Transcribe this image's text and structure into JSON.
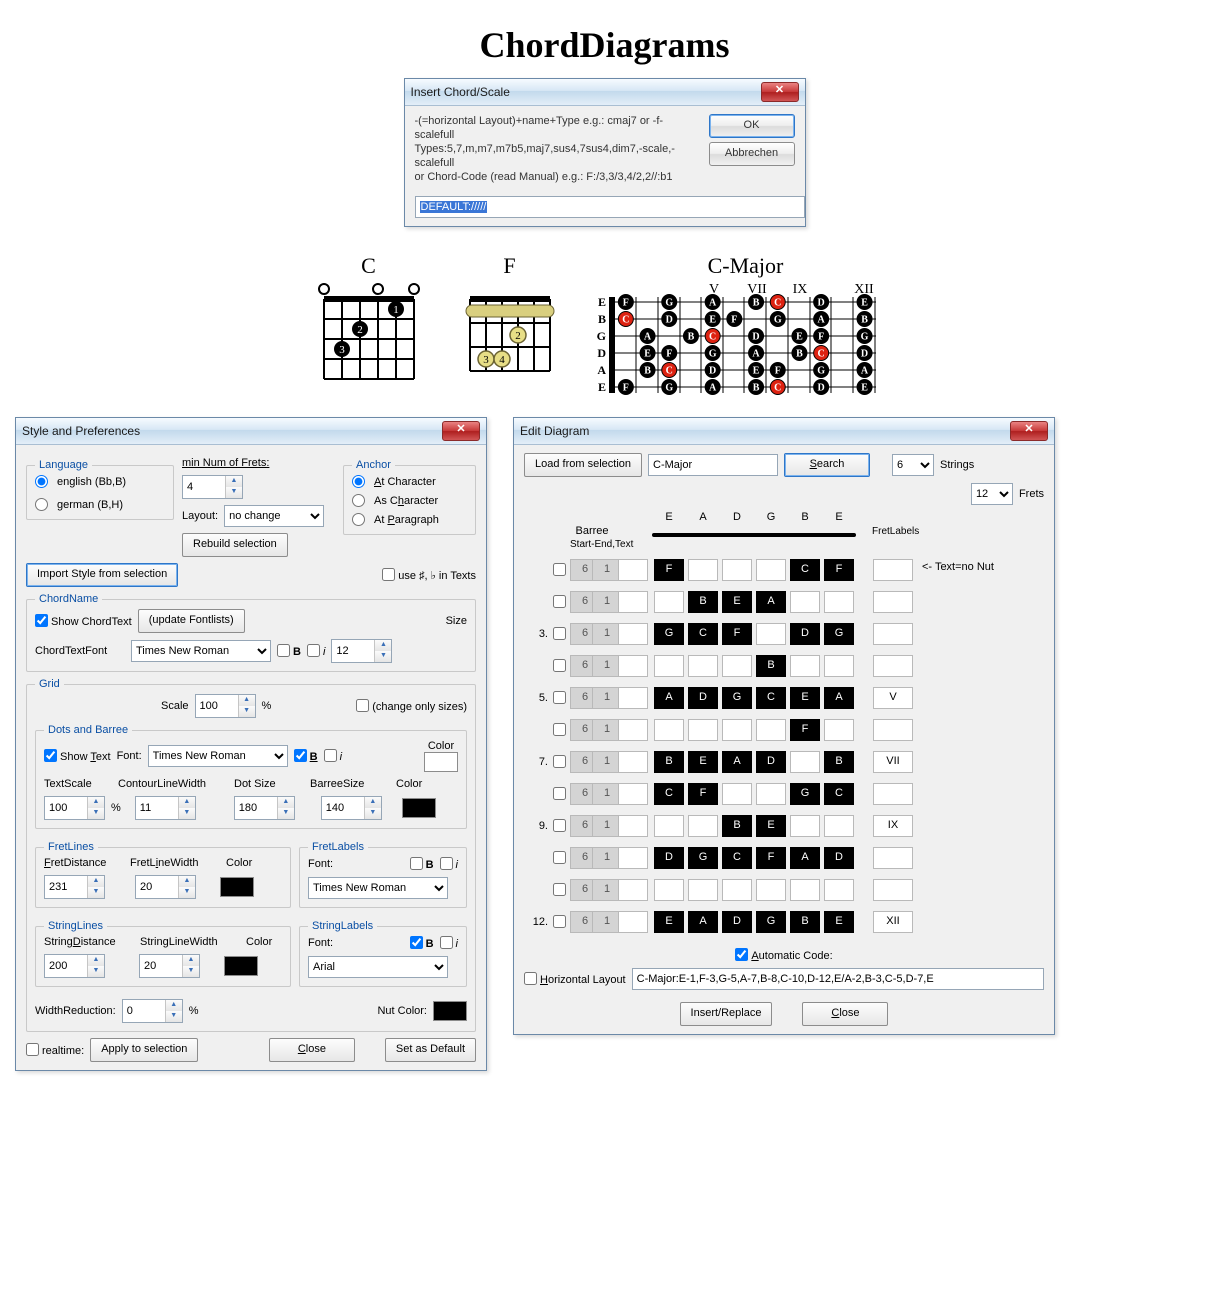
{
  "title": "ChordDiagrams",
  "insert_dialog": {
    "title": "Insert Chord/Scale",
    "help_line1": "-(=horizontal Layout)+name+Type e.g.: cmaj7 or -f-scalefull",
    "help_line2": "Types:5,7,m,m7,m7b5,maj7,sus4,7sus4,dim7,-scale,-scalefull",
    "help_line3": "or Chord-Code (read Manual) e.g.: F:/3,3/3,4/2,2//:b1",
    "ok": "OK",
    "cancel": "Abbrechen",
    "value": "DEFAULT://///"
  },
  "samples": {
    "c_title": "C",
    "f_title": "F",
    "cmajor_title": "C-Major"
  },
  "style_dialog": {
    "title": "Style and Preferences",
    "language_legend": "Language",
    "english": "english (Bb,B)",
    "german": "german (B,H)",
    "min_frets_label": "min Num of Frets:",
    "min_frets": "4",
    "layout_label": "Layout:",
    "layout_value": "no change",
    "rebuild": "Rebuild selection",
    "anchor_legend": "Anchor",
    "anchor_at_char_u": "A",
    "anchor_at_char": "t Character",
    "anchor_as_char": "As C",
    "anchor_as_char_u": "h",
    "anchor_as_char2": "aracter",
    "anchor_at_para": "At ",
    "anchor_at_para_u": "P",
    "anchor_at_para2": "aragraph",
    "import_style": "Import Style from selection",
    "use_sharps": "use ♯, ♭ in Texts",
    "chordname_legend": "ChordName",
    "show_chordtext": "Show ChordText",
    "update_fontlists": "(update Fontlists)",
    "chordtextfont_label": "ChordTextFont",
    "chordtextfont_value": "Times New Roman",
    "size_label": "Size",
    "size_value": "12",
    "b_label": "B",
    "i_label": "i",
    "grid_legend": "Grid",
    "scale_label": "Scale",
    "scale_value": "100",
    "percent": "%",
    "change_sizes": "(change only sizes)",
    "dots_legend": "Dots and Barree",
    "show_text": "Show ",
    "show_text_u": "T",
    "show_text2": "ext",
    "font_label": "Font:",
    "dots_font_value": "Times New Roman",
    "color_label": "Color",
    "textscale_label": "TextScale",
    "textscale_value": "100",
    "contour_label": "ContourLineWidth",
    "contour_value": "11",
    "dotsize_label": "Dot Size",
    "dotsize_value": "180",
    "barreesize_label": "BarreeSize",
    "barreesize_value": "140",
    "fretlines_legend": "FretLines",
    "fretdistance_u": "F",
    "fretdistance": "retDistance",
    "fretdistance_value": "231",
    "fretlinewidth": "FretL",
    "fretlinewidth_u": "i",
    "fretlinewidth2": "neWidth",
    "fretlinewidth_value": "20",
    "fretlabels_legend": "FretLabels",
    "fretlabels_font_value": "Times New Roman",
    "stringlines_legend": "StringLines",
    "stringdistance": "String",
    "stringdistance_u": "D",
    "stringdistance2": "istance",
    "stringdistance_value": "200",
    "stringlinewidth_label": "StringLineWidth",
    "stringlinewidth_value": "20",
    "stringlabels_legend": "StringLabels",
    "stringlabels_font_value": "Arial",
    "widthreduction_label": "WidthReduction:",
    "widthreduction_value": "0",
    "nutcolor_label": "Nut Color:",
    "realtime": "realtime:",
    "apply": "Apply to selection",
    "close_u": "C",
    "close": "lose",
    "setdefault": "Set as Default"
  },
  "edit_dialog": {
    "title": "Edit Diagram",
    "load": "Load from selection",
    "name_value": "C-Major",
    "search_u": "S",
    "search": "earch",
    "strings_value": "6",
    "strings_label": "Strings",
    "frets_value": "12",
    "frets_label": "Frets",
    "barree_label": "Barree",
    "barree_sub": "Start-End,Text",
    "fretlabels_label": "FretLabels",
    "nonut_label": "<- Text=no Nut",
    "string_headers": [
      "E",
      "A",
      "D",
      "G",
      "B",
      "E"
    ],
    "rows": [
      {
        "n": "",
        "be": [
          "6",
          "1"
        ],
        "cells": [
          "F",
          "",
          "",
          "",
          "C",
          "F"
        ],
        "lbl": ""
      },
      {
        "n": "",
        "be": [
          "6",
          "1"
        ],
        "cells": [
          "",
          "B",
          "E",
          "A",
          "",
          ""
        ],
        "lbl": ""
      },
      {
        "n": "3.",
        "be": [
          "6",
          "1"
        ],
        "cells": [
          "G",
          "C",
          "F",
          "",
          "D",
          "G"
        ],
        "lbl": ""
      },
      {
        "n": "",
        "be": [
          "6",
          "1"
        ],
        "cells": [
          "",
          "",
          "",
          "B",
          "",
          ""
        ],
        "lbl": ""
      },
      {
        "n": "5.",
        "be": [
          "6",
          "1"
        ],
        "cells": [
          "A",
          "D",
          "G",
          "C",
          "E",
          "A"
        ],
        "lbl": "V"
      },
      {
        "n": "",
        "be": [
          "6",
          "1"
        ],
        "cells": [
          "",
          "",
          "",
          "",
          "F",
          ""
        ],
        "lbl": ""
      },
      {
        "n": "7.",
        "be": [
          "6",
          "1"
        ],
        "cells": [
          "B",
          "E",
          "A",
          "D",
          "",
          "B"
        ],
        "lbl": "VII"
      },
      {
        "n": "",
        "be": [
          "6",
          "1"
        ],
        "cells": [
          "C",
          "F",
          "",
          "",
          "G",
          "C"
        ],
        "lbl": ""
      },
      {
        "n": "9.",
        "be": [
          "6",
          "1"
        ],
        "cells": [
          "",
          "",
          "B",
          "E",
          "",
          ""
        ],
        "lbl": "IX"
      },
      {
        "n": "",
        "be": [
          "6",
          "1"
        ],
        "cells": [
          "D",
          "G",
          "C",
          "F",
          "A",
          "D"
        ],
        "lbl": ""
      },
      {
        "n": "",
        "be": [
          "6",
          "1"
        ],
        "cells": [
          "",
          "",
          "",
          "",
          "",
          ""
        ],
        "lbl": ""
      },
      {
        "n": "12.",
        "be": [
          "6",
          "1"
        ],
        "cells": [
          "E",
          "A",
          "D",
          "G",
          "B",
          "E"
        ],
        "lbl": "XII"
      }
    ],
    "auto_code_u": "A",
    "auto_code": "utomatic Code:",
    "horiz_u": "H",
    "horiz": "orizontal Layout",
    "code_value": "C-Major:E-1,F-3,G-5,A-7,B-8,C-10,D-12,E/A-2,B-3,C-5,D-7,E",
    "insert_replace": "Insert/Replace",
    "close_u": "C",
    "close": "lose"
  }
}
